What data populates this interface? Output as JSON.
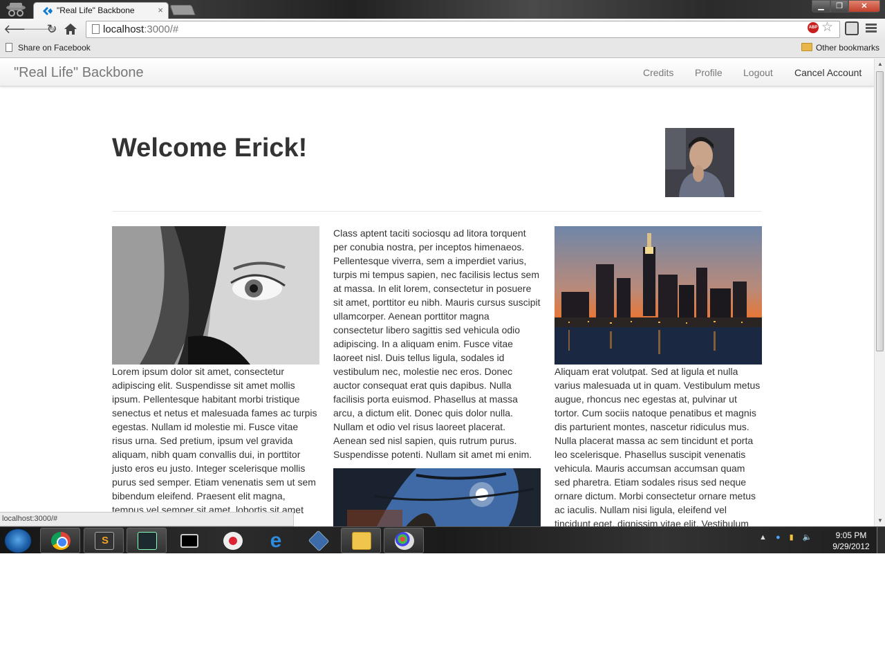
{
  "browser": {
    "tab_title": "\"Real Life\" Backbone",
    "tab_close": "×",
    "url_host": "localhost",
    "url_rest": ":3000/#",
    "abp_label": "ABP",
    "bookmarks": {
      "share_on_facebook": "Share on Facebook",
      "other_bookmarks": "Other bookmarks"
    },
    "status_url": "localhost:3000/#"
  },
  "app": {
    "brand": "\"Real Life\" Backbone",
    "nav": {
      "credits": "Credits",
      "profile": "Profile",
      "logout": "Logout",
      "cancel_account": "Cancel Account"
    },
    "welcome": "Welcome Erick!",
    "columns": {
      "left_text": "Lorem ipsum dolor sit amet, consectetur adipiscing elit. Suspendisse sit amet mollis ipsum. Pellentesque habitant morbi tristique senectus et netus et malesuada fames ac turpis egestas. Nullam id molestie mi. Fusce vitae risus urna. Sed pretium, ipsum vel gravida aliquam, nibh quam convallis dui, in porttitor justo eros eu justo. Integer scelerisque mollis purus sed semper. Etiam venenatis sem ut sem bibendum eleifend. Praesent elit magna, tempus vel semper sit amet, lobortis sit amet",
      "middle_text": "Class aptent taciti sociosqu ad litora torquent per conubia nostra, per inceptos himenaeos. Pellentesque viverra, sem a imperdiet varius, turpis mi tempus sapien, nec facilisis lectus sem at massa. In elit lorem, consectetur in posuere sit amet, porttitor eu nibh. Mauris cursus suscipit ullamcorper. Aenean porttitor magna consectetur libero sagittis sed vehicula odio adipiscing. In a aliquam enim. Fusce vitae laoreet nisl. Duis tellus ligula, sodales id vestibulum nec, molestie nec eros. Donec auctor consequat erat quis dapibus. Nulla facilisis porta euismod. Phasellus at massa arcu, a dictum elit. Donec quis dolor nulla. Nullam et odio vel risus laoreet placerat. Aenean sed nisl sapien, quis rutrum purus. Suspendisse potenti. Nullam sit amet mi enim.",
      "right_text": "Aliquam erat volutpat. Sed at ligula et nulla varius malesuada ut in quam. Vestibulum metus augue, rhoncus nec egestas at, pulvinar ut tortor. Cum sociis natoque penatibus et magnis dis parturient montes, nascetur ridiculus mus. Nulla placerat massa ac sem tincidunt et porta leo scelerisque. Phasellus suscipit venenatis vehicula. Mauris accumsan accumsan quam sed pharetra. Etiam sodales risus sed neque ornare dictum. Morbi consectetur ornare metus ac iaculis. Nullam nisi ligula, eleifend vel tincidunt eget, dignissim vitae elit. Vestibulum"
    }
  },
  "taskbar": {
    "time": "9:05 PM",
    "date": "9/29/2012",
    "ie_glyph": "e",
    "tray_arrow": "▲"
  },
  "colors": {
    "navbar_text": "#777777",
    "heading": "#333333",
    "body_text": "#333333",
    "abp_red": "#c8201f"
  },
  "icons": [
    "incognito-icon",
    "favicon",
    "back-icon",
    "forward-icon",
    "reload-icon",
    "home-icon",
    "page-icon",
    "abp-icon",
    "star-icon",
    "extension-icon",
    "wrench-icon",
    "folder-icon",
    "start-orb",
    "chrome-icon",
    "sublime-icon",
    "console-icon",
    "cmd-icon",
    "snipping-icon",
    "ie-icon",
    "virtualbox-icon",
    "explorer-icon",
    "paint-icon",
    "network-icon",
    "power-icon",
    "volume-icon"
  ]
}
